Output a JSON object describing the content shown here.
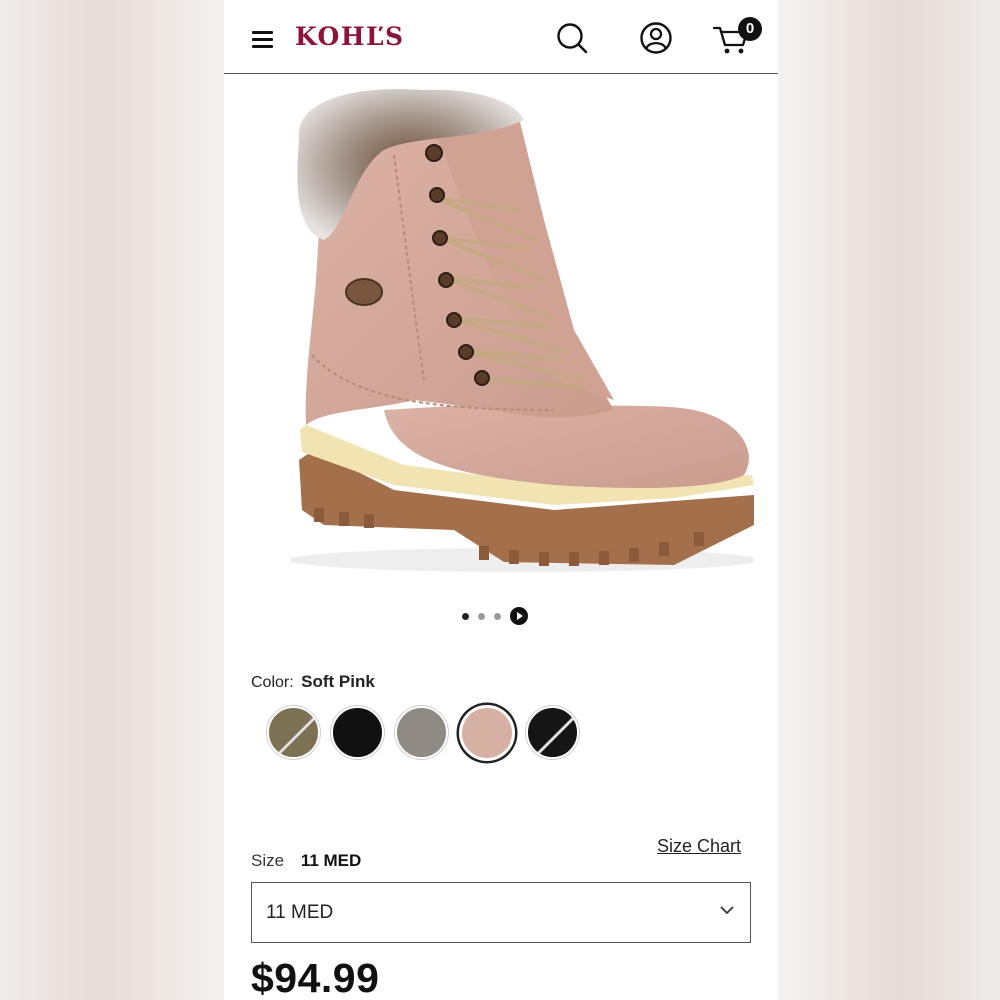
{
  "header": {
    "logo": "KOHĽS",
    "cart_count": "0",
    "icons": [
      "hamburger-menu-icon",
      "search-icon",
      "account-icon",
      "cart-icon"
    ]
  },
  "gallery": {
    "image": "pink lace-up boot with faux fur collar",
    "dots": 3,
    "active_dot": 0
  },
  "color": {
    "label": "Color:",
    "selected": "Soft Pink",
    "swatches": [
      {
        "name": "olive suede two-tone",
        "hex": "#7d7154",
        "stripe": true
      },
      {
        "name": "black",
        "hex": "#111111",
        "stripe": false
      },
      {
        "name": "grey",
        "hex": "#8f8a83",
        "stripe": false
      },
      {
        "name": "soft pink",
        "hex": "#d6b0a3",
        "stripe": false,
        "selected": true
      },
      {
        "name": "black two-tone",
        "hex": "#151515",
        "stripe": true
      }
    ]
  },
  "size": {
    "label": "Size",
    "selected": "11 MED",
    "chart_link": "Size Chart",
    "select_value": "11 MED"
  },
  "price": "$94.99",
  "colors": {
    "brand": "#8b1538",
    "text": "#111111"
  }
}
